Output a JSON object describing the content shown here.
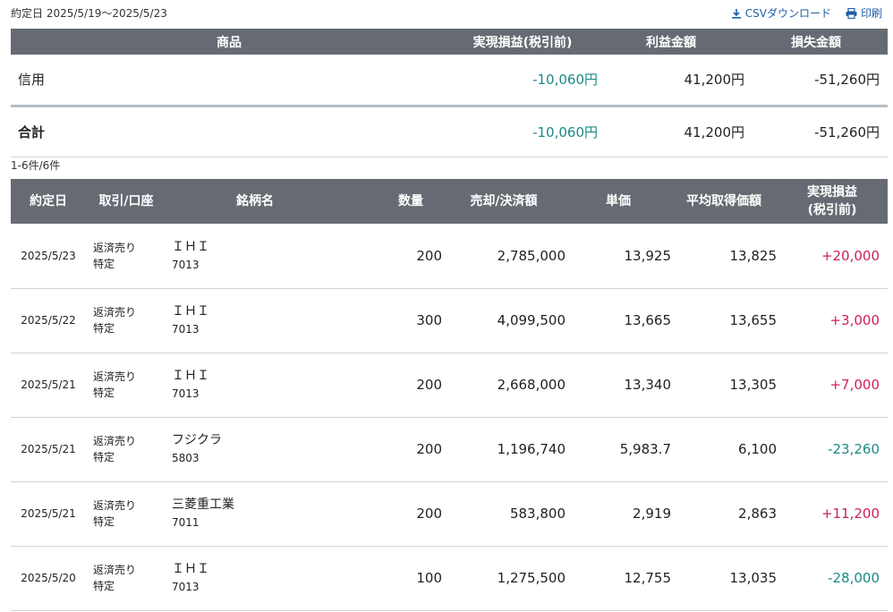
{
  "header": {
    "period": "約定日 2025/5/19〜2025/5/23",
    "csv_label": "CSVダウンロード",
    "print_label": "印刷"
  },
  "summary": {
    "columns": [
      "商品",
      "実現損益(税引前)",
      "利益金額",
      "損失金額"
    ],
    "rows": [
      {
        "label": "信用",
        "realized": "-10,060円",
        "profit": "41,200円",
        "loss": "-51,260円"
      }
    ],
    "total": {
      "label": "合計",
      "realized": "-10,060円",
      "profit": "41,200円",
      "loss": "-51,260円"
    }
  },
  "count_text": "1-6件/6件",
  "detail": {
    "columns": {
      "date": "約定日",
      "type": "取引/口座",
      "name": "銘柄名",
      "qty": "数量",
      "amount": "売却/決済額",
      "price": "単価",
      "avg": "平均取得価額",
      "pl_line1": "実現損益",
      "pl_line2": "(税引前)"
    },
    "rows": [
      {
        "date": "2025/5/23",
        "trade": "返済売り",
        "account": "特定",
        "name": "ＩＨＩ",
        "code": "7013",
        "qty": "200",
        "amount": "2,785,000",
        "price": "13,925",
        "avg": "13,825",
        "pl": "+20,000"
      },
      {
        "date": "2025/5/22",
        "trade": "返済売り",
        "account": "特定",
        "name": "ＩＨＩ",
        "code": "7013",
        "qty": "300",
        "amount": "4,099,500",
        "price": "13,665",
        "avg": "13,655",
        "pl": "+3,000"
      },
      {
        "date": "2025/5/21",
        "trade": "返済売り",
        "account": "特定",
        "name": "ＩＨＩ",
        "code": "7013",
        "qty": "200",
        "amount": "2,668,000",
        "price": "13,340",
        "avg": "13,305",
        "pl": "+7,000"
      },
      {
        "date": "2025/5/21",
        "trade": "返済売り",
        "account": "特定",
        "name": "フジクラ",
        "code": "5803",
        "qty": "200",
        "amount": "1,196,740",
        "price": "5,983.7",
        "avg": "6,100",
        "pl": "-23,260"
      },
      {
        "date": "2025/5/21",
        "trade": "返済売り",
        "account": "特定",
        "name": "三菱重工業",
        "code": "7011",
        "qty": "200",
        "amount": "583,800",
        "price": "2,919",
        "avg": "2,863",
        "pl": "+11,200"
      },
      {
        "date": "2025/5/20",
        "trade": "返済売り",
        "account": "特定",
        "name": "ＩＨＩ",
        "code": "7013",
        "qty": "100",
        "amount": "1,275,500",
        "price": "12,755",
        "avg": "13,035",
        "pl": "-28,000"
      }
    ]
  },
  "colors": {
    "header_bg": "#666b73",
    "positive": "#cc1f5b",
    "negative": "#1a8a86",
    "link": "#1f5fa8"
  }
}
